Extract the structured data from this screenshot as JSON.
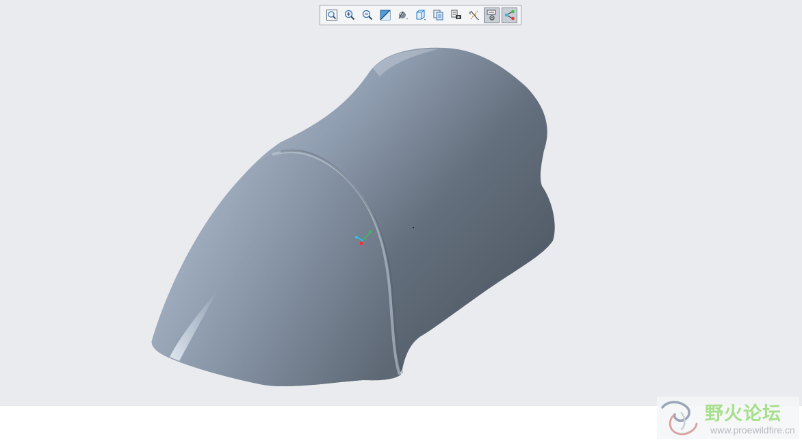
{
  "toolbar": {
    "buttons": [
      {
        "icon": "zoom-fit-icon",
        "active": false
      },
      {
        "icon": "zoom-in-icon",
        "active": false
      },
      {
        "icon": "zoom-out-icon",
        "active": false
      },
      {
        "icon": "repaint-icon",
        "active": false
      },
      {
        "icon": "display-style-icon",
        "active": false
      },
      {
        "icon": "saved-orientations-icon",
        "active": false
      },
      {
        "icon": "view-manager-icon",
        "active": false
      },
      {
        "icon": "perspective-view-icon",
        "active": false
      },
      {
        "icon": "datum-display-filters-icon",
        "active": false
      },
      {
        "icon": "annotation-display-icon",
        "active": true
      },
      {
        "icon": "spin-center-icon",
        "active": true
      }
    ]
  },
  "viewport": {
    "background": "#e9ebee",
    "model_shade_light": "#a7b4c5",
    "model_shade_dark": "#56606c"
  },
  "triad": {
    "x_color": "#ff2a2a",
    "y_color": "#22cc44",
    "z_color": "#22ccee"
  },
  "watermark": {
    "title": "野火论坛",
    "url": "www.proewildfire.cn"
  }
}
